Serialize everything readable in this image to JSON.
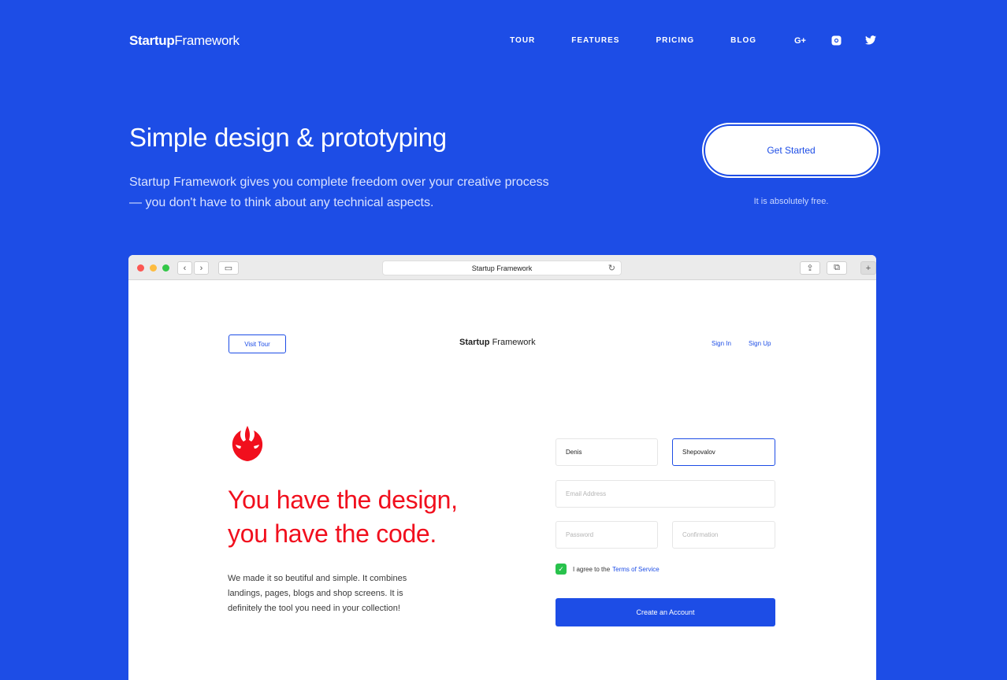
{
  "header": {
    "brand_bold": "Startup",
    "brand_light": "Framework",
    "nav": [
      "TOUR",
      "FEATURES",
      "PRICING",
      "BLOG"
    ],
    "social": [
      {
        "icon": "google-plus-icon",
        "glyph": "G+"
      },
      {
        "icon": "instagram-icon",
        "glyph": "◘"
      },
      {
        "icon": "twitter-icon",
        "glyph": "🐦"
      }
    ]
  },
  "hero": {
    "title": "Simple design & prototyping",
    "text": "Startup Framework gives you complete freedom over your creative process — you don't have to think about any technical aspects.",
    "cta_label": "Get Started",
    "cta_note": "It is absolutely free."
  },
  "browser": {
    "url_title": "Startup Framework",
    "page": {
      "visit_tour": "Visit Tour",
      "brand_bold": "Startup",
      "brand_light": "Framework",
      "sign_in": "Sign In",
      "sign_up": "Sign Up",
      "headline_line1": "You have the design,",
      "headline_line2": "you have the code.",
      "body": "We made it so beutiful and simple. It combines landings, pages, blogs and shop screens. It is definitely the tool you need in your collection!",
      "form": {
        "first_name": "Denis",
        "last_name": "Shepovalov",
        "email_placeholder": "Email Address",
        "password_placeholder": "Password",
        "confirmation_placeholder": "Confirmation",
        "agree_text": "I agree to the",
        "terms_link": "Terms of Service",
        "submit_label": "Create an Account"
      }
    }
  },
  "colors": {
    "background": "#1d4de6",
    "headline_red": "#f10f1d",
    "checkbox_green": "#28c24c"
  }
}
